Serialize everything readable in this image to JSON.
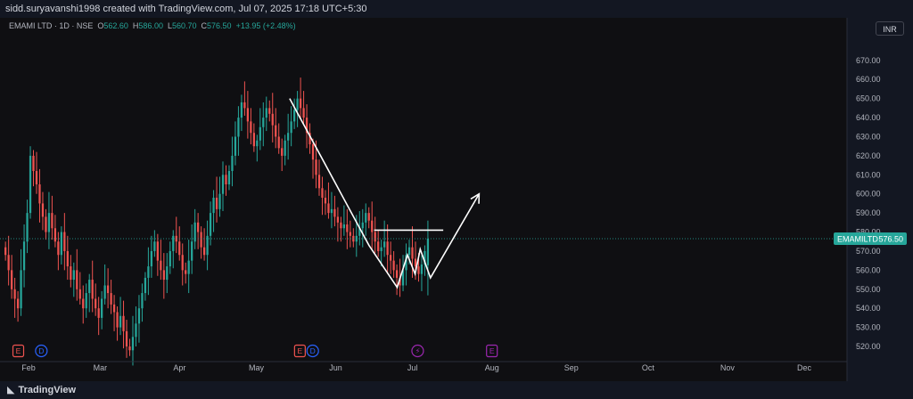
{
  "header": {
    "created_by": "sidd.suryavanshi1998 created with TradingView.com, Jul 07, 2025 17:18 UTC+5:30"
  },
  "legend": {
    "symbol": "EMAMI LTD · 1D · NSE",
    "open_label": "O",
    "open": "562.60",
    "high_label": "H",
    "high": "586.00",
    "low_label": "L",
    "low": "560.70",
    "close_label": "C",
    "close": "576.50",
    "change": "+13.95 (+2.48%)"
  },
  "currency": "INR",
  "price_tag": {
    "symbol": "EMAMILTD",
    "price": "576.50"
  },
  "footer": {
    "brand": "TradingView"
  },
  "colors": {
    "up": "#26a69a",
    "down": "#ef5350",
    "background": "#0f0f12"
  },
  "event_markers": [
    {
      "letter": "E",
      "date": "2025-01-28",
      "color": "#ef5350"
    },
    {
      "letter": "D",
      "date": "2025-02-06",
      "color": "#2962ff"
    },
    {
      "letter": "E",
      "date": "2025-05-18",
      "color": "#ef5350"
    },
    {
      "letter": "D",
      "date": "2025-05-23",
      "color": "#2962ff"
    },
    {
      "letter": "⚡",
      "date": "2025-07-03",
      "color": "#9c27b0"
    },
    {
      "letter": "E",
      "date": "2025-08-01",
      "color": "#9c27b0"
    }
  ],
  "chart_data": {
    "type": "candlestick",
    "x_axis": {
      "labels": [
        "Feb",
        "Mar",
        "Apr",
        "May",
        "Jun",
        "Jul",
        "Aug",
        "Sep",
        "Oct",
        "Nov",
        "Dec"
      ],
      "dates": [
        "2025-02-01",
        "2025-03-01",
        "2025-04-01",
        "2025-05-01",
        "2025-06-01",
        "2025-07-01",
        "2025-08-01",
        "2025-09-01",
        "2025-10-01",
        "2025-11-01",
        "2025-12-01"
      ]
    },
    "y_axis": {
      "ticks": [
        520,
        530,
        540,
        550,
        560,
        570,
        580,
        590,
        600,
        610,
        620,
        630,
        640,
        650,
        660,
        670
      ],
      "tick_labels": [
        "520.00",
        "530.00",
        "540.00",
        "550.00",
        "560.00",
        "570.00",
        "580.00",
        "590.00",
        "600.00",
        "610.00",
        "620.00",
        "630.00",
        "640.00",
        "650.00",
        "660.00",
        "670.00"
      ],
      "range": [
        513,
        683
      ]
    },
    "current_price": 576.5,
    "date_range": [
      "2025-01-23",
      "2025-07-07"
    ],
    "closes": [
      568,
      560,
      550,
      545,
      540,
      560,
      575,
      590,
      620,
      612,
      605,
      595,
      588,
      580,
      590,
      582,
      575,
      568,
      580,
      570,
      562,
      555,
      560,
      550,
      545,
      540,
      548,
      555,
      545,
      540,
      535,
      545,
      552,
      548,
      542,
      538,
      530,
      536,
      528,
      520,
      518,
      525,
      532,
      540,
      548,
      556,
      562,
      570,
      575,
      565,
      560,
      555,
      562,
      570,
      578,
      575,
      568,
      560,
      558,
      565,
      575,
      585,
      580,
      572,
      568,
      578,
      590,
      598,
      592,
      600,
      610,
      605,
      612,
      620,
      630,
      640,
      648,
      645,
      638,
      632,
      625,
      628,
      635,
      640,
      645,
      642,
      636,
      630,
      624,
      620,
      628,
      632,
      638,
      644,
      650,
      645,
      640,
      632,
      626,
      618,
      610,
      603,
      598,
      595,
      590,
      592,
      588,
      585,
      582,
      584,
      580,
      578,
      575,
      578,
      582,
      585,
      590,
      586,
      580,
      575,
      570,
      572,
      575,
      568,
      565,
      560,
      556,
      552,
      560,
      568,
      572,
      566,
      562,
      558,
      563,
      570,
      576.5
    ],
    "annotations": [
      {
        "type": "zigzag_arrow",
        "points": [
          [
            650,
            "2025-05-14"
          ],
          [
            573,
            "2025-06-14"
          ],
          [
            551,
            "2025-06-25"
          ],
          [
            568,
            "2025-06-29"
          ],
          [
            558,
            "2025-07-02"
          ],
          [
            571,
            "2025-07-04"
          ],
          [
            556,
            "2025-07-08"
          ],
          [
            600,
            "2025-07-27"
          ]
        ]
      },
      {
        "type": "horizontal_line",
        "price": 581,
        "from": "2025-06-16",
        "to": "2025-07-13"
      }
    ]
  }
}
